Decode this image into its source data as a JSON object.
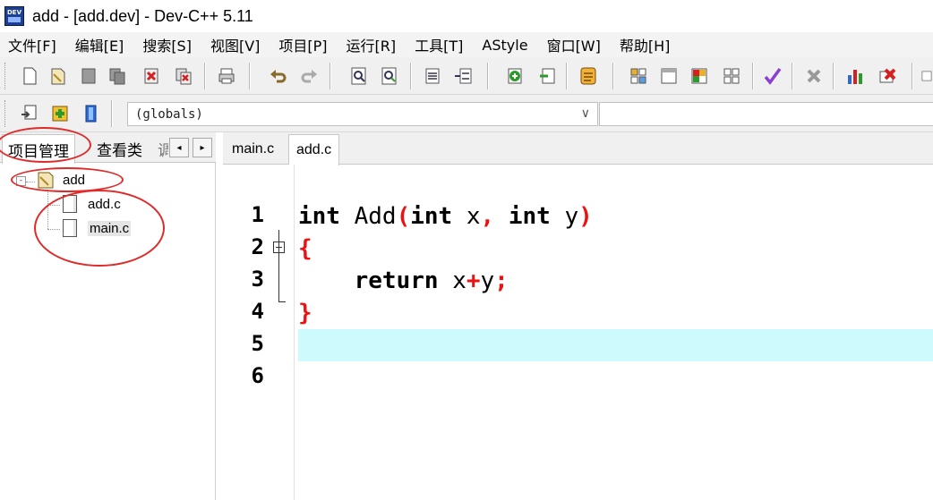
{
  "window": {
    "title": "add - [add.dev] - Dev-C++ 5.11",
    "icon": "devcpp-app-icon",
    "icon_text": "DEV"
  },
  "menu": [
    {
      "label": "文件[F]"
    },
    {
      "label": "编辑[E]"
    },
    {
      "label": "搜索[S]"
    },
    {
      "label": "视图[V]"
    },
    {
      "label": "项目[P]"
    },
    {
      "label": "运行[R]"
    },
    {
      "label": "工具[T]"
    },
    {
      "label": "AStyle"
    },
    {
      "label": "窗口[W]"
    },
    {
      "label": "帮助[H]"
    }
  ],
  "toolbar": {
    "main_icons": [
      "new-file-icon",
      "open-file-icon",
      "save-icon",
      "save-all-icon",
      "close-icon",
      "close-all-icon",
      "print-icon",
      "undo-icon",
      "redo-icon",
      "find-icon",
      "replace-icon",
      "indent-icon",
      "unindent-icon",
      "add-to-project-icon",
      "remove-from-project-icon",
      "compile-icon",
      "tile-icon",
      "window-icon",
      "color-grid-icon",
      "windows-icon",
      "check-icon",
      "delete-icon",
      "chart-icon",
      "debug-stop-icon"
    ],
    "secondary_icons": [
      "new-project-icon",
      "insert-icon",
      "toggle-bookmark-icon"
    ],
    "scope_select": {
      "value": "(globals)"
    },
    "colors": {
      "accent_green": "#2e9a2e",
      "accent_red": "#d42020",
      "accent_purple": "#8a3fd1"
    }
  },
  "left_panel": {
    "tabs": [
      "项目管理",
      "查看类",
      "调"
    ],
    "scroll_left": "◂",
    "scroll_right": "▸",
    "tree": {
      "project": "add",
      "files": [
        "add.c",
        "main.c"
      ]
    },
    "expander": "-"
  },
  "editor": {
    "tabs": [
      "main.c",
      "add.c"
    ],
    "active_tab": "add.c",
    "line_numbers": [
      "1",
      "2",
      "3",
      "4",
      "5",
      "6"
    ],
    "code": {
      "line2": {
        "kw1": "int",
        "name": " Add",
        "lp": "(",
        "kw2": "int",
        "p1": " x",
        "comma": ",",
        "kw3": " int",
        "p2": " y",
        "rp": ")"
      },
      "line3": {
        "brace": "{"
      },
      "line4": {
        "indent": "    ",
        "kw": "return",
        "a": " x",
        "op": "+",
        "b": "y",
        "semi": ";"
      },
      "line5": {
        "brace": "}"
      }
    },
    "current_line": 6,
    "current_line_color": "#cdfafd",
    "annotation_color": "#e02a2a"
  }
}
